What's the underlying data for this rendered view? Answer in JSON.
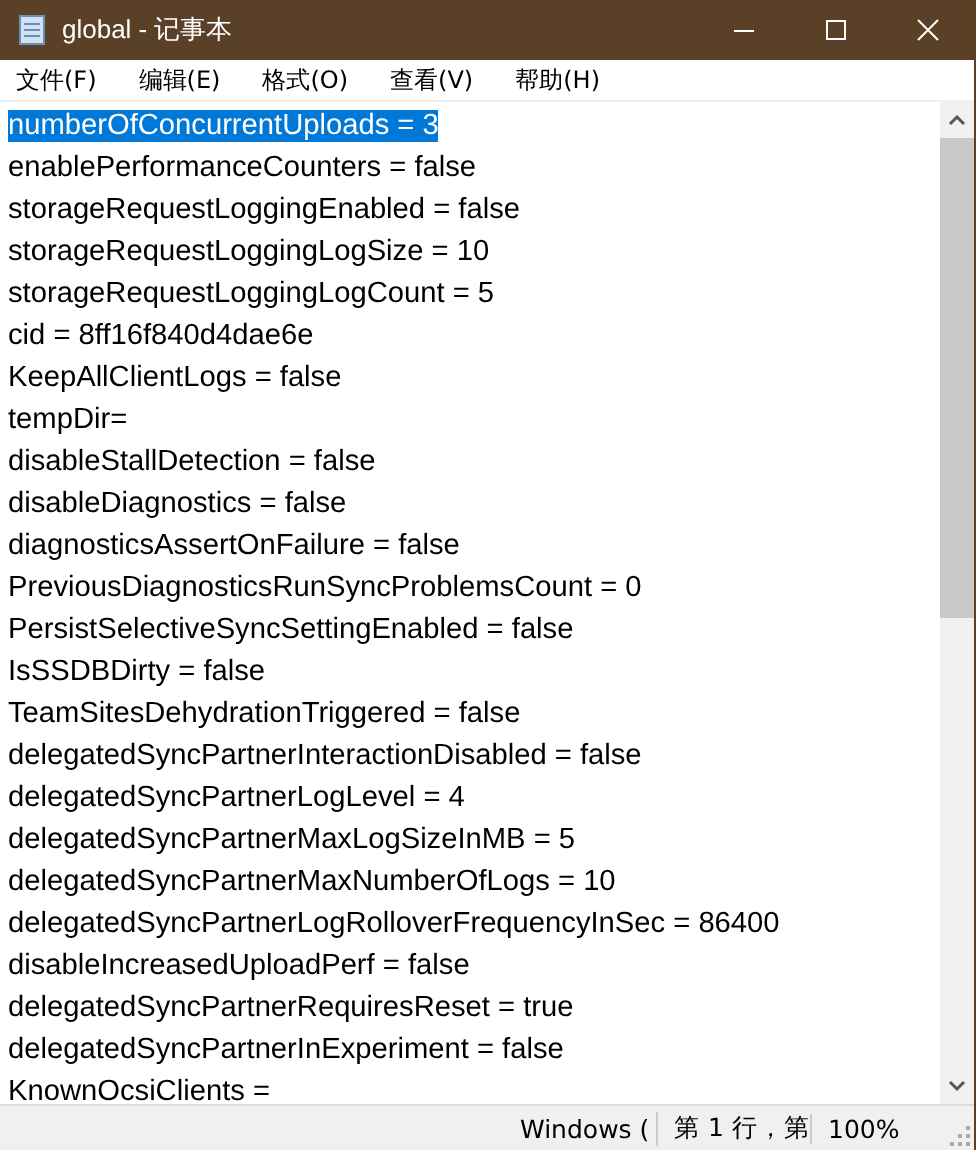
{
  "window": {
    "title": "global - 记事本"
  },
  "menu": [
    "文件(F)",
    "编辑(E)",
    "格式(O)",
    "查看(V)",
    "帮助(H)"
  ],
  "lines": [
    {
      "text": "numberOfConcurrentUploads = 3",
      "selected": true
    },
    {
      "text": "enablePerformanceCounters = false",
      "selected": false
    },
    {
      "text": "storageRequestLoggingEnabled = false",
      "selected": false
    },
    {
      "text": "storageRequestLoggingLogSize = 10",
      "selected": false
    },
    {
      "text": "storageRequestLoggingLogCount = 5",
      "selected": false
    },
    {
      "text": "cid = 8ff16f840d4dae6e",
      "selected": false
    },
    {
      "text": "KeepAllClientLogs = false",
      "selected": false
    },
    {
      "text": "tempDir=",
      "selected": false
    },
    {
      "text": "disableStallDetection = false",
      "selected": false
    },
    {
      "text": "disableDiagnostics = false",
      "selected": false
    },
    {
      "text": "diagnosticsAssertOnFailure = false",
      "selected": false
    },
    {
      "text": "PreviousDiagnosticsRunSyncProblemsCount = 0",
      "selected": false
    },
    {
      "text": "PersistSelectiveSyncSettingEnabled = false",
      "selected": false
    },
    {
      "text": "IsSSDBDirty = false",
      "selected": false
    },
    {
      "text": "TeamSitesDehydrationTriggered = false",
      "selected": false
    },
    {
      "text": "delegatedSyncPartnerInteractionDisabled = false",
      "selected": false
    },
    {
      "text": "delegatedSyncPartnerLogLevel = 4",
      "selected": false
    },
    {
      "text": "delegatedSyncPartnerMaxLogSizeInMB = 5",
      "selected": false
    },
    {
      "text": "delegatedSyncPartnerMaxNumberOfLogs = 10",
      "selected": false
    },
    {
      "text": "delegatedSyncPartnerLogRolloverFrequencyInSec = 86400",
      "selected": false
    },
    {
      "text": "disableIncreasedUploadPerf = false",
      "selected": false
    },
    {
      "text": "delegatedSyncPartnerRequiresReset = true",
      "selected": false
    },
    {
      "text": "delegatedSyncPartnerInExperiment = false",
      "selected": false
    },
    {
      "text": "KnownOcsiClients =",
      "selected": false
    }
  ],
  "status_bar": {
    "encoding": "Windows (",
    "position": "第 1 行，第",
    "zoom": "100%"
  }
}
